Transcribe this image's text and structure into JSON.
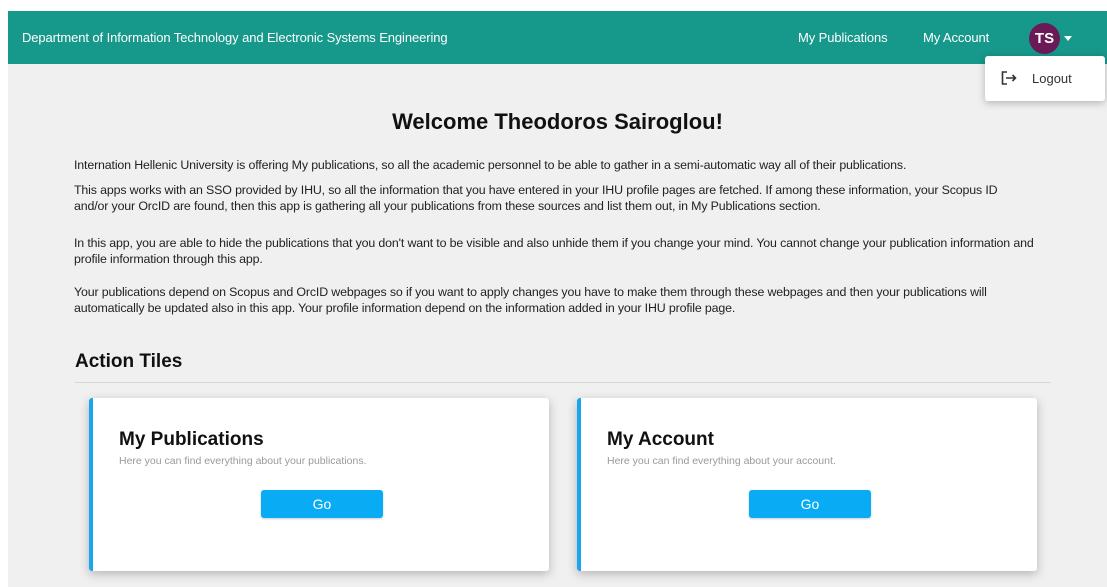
{
  "navbar": {
    "brand": "Department of Information Technology and Electronic Systems Engineering",
    "links": [
      "My Publications",
      "My Account"
    ],
    "avatar_initials": "TS",
    "colors": {
      "navbar": "#16988a",
      "avatar": "#6a1a57"
    }
  },
  "user_menu": {
    "items": [
      {
        "label": "Logout",
        "icon": "logout-icon"
      }
    ]
  },
  "main": {
    "welcome": "Welcome Theodoros Sairoglou!",
    "paragraphs": [
      "Internation Hellenic University is offering My publications, so all the academic personnel to be able to gather in a semi-automatic way all of their publications.",
      "This apps works with an SSO provided by IHU, so all the information that you have entered in your IHU profile pages are fetched. If among these information, your Scopus ID and/or your OrcID are found, then this app is gathering all your publications from these sources and list them out, in My Publications section.",
      "In this app, you are able to hide the publications that you don't want to be visible and also unhide them if you change your mind. You cannot change your publication information and profile information through this app.",
      "Your publications depend on Scopus and OrcID webpages so if you want to apply changes you have to make them through these webpages and then your publications will automatically be updated also in this app. Your profile information depend on the information added in your IHU profile page."
    ],
    "section_title": "Action Tiles",
    "tiles": [
      {
        "title": "My Publications",
        "subtitle": "Here you can find everything about your publications.",
        "button": "Go"
      },
      {
        "title": "My Account",
        "subtitle": "Here you can find everything about your account.",
        "button": "Go"
      }
    ],
    "colors": {
      "accent": "#0aabf5",
      "tile_border": "#1aa6ee",
      "background": "#f0f0f0"
    }
  }
}
